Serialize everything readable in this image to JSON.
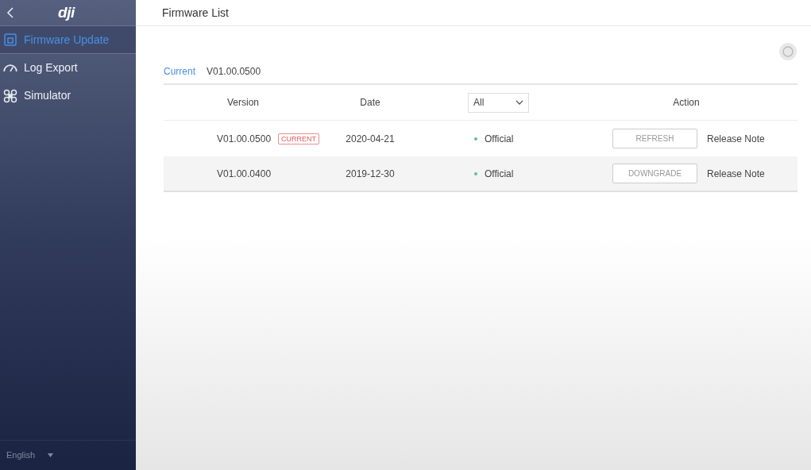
{
  "sidebar": {
    "logo": "dji",
    "items": [
      {
        "label": "Firmware Update",
        "selected": true
      },
      {
        "label": "Log Export",
        "selected": false
      },
      {
        "label": "Simulator",
        "selected": false
      }
    ],
    "language": "English"
  },
  "header": {
    "title": "Firmware List"
  },
  "current": {
    "label": "Current",
    "value": "V01.00.0500"
  },
  "table": {
    "columns": [
      "Version",
      "Date",
      "All",
      "Action"
    ],
    "rows": [
      {
        "version": "V01.00.0500",
        "badge": "CURRENT",
        "date": "2020-04-21",
        "type": "Official",
        "button": "REFRESH",
        "link": "Release Note"
      },
      {
        "version": "V01.00.0400",
        "date": "2019-12-30",
        "type": "Official",
        "button": "DOWNGRADE",
        "link": "Release Note"
      }
    ]
  }
}
